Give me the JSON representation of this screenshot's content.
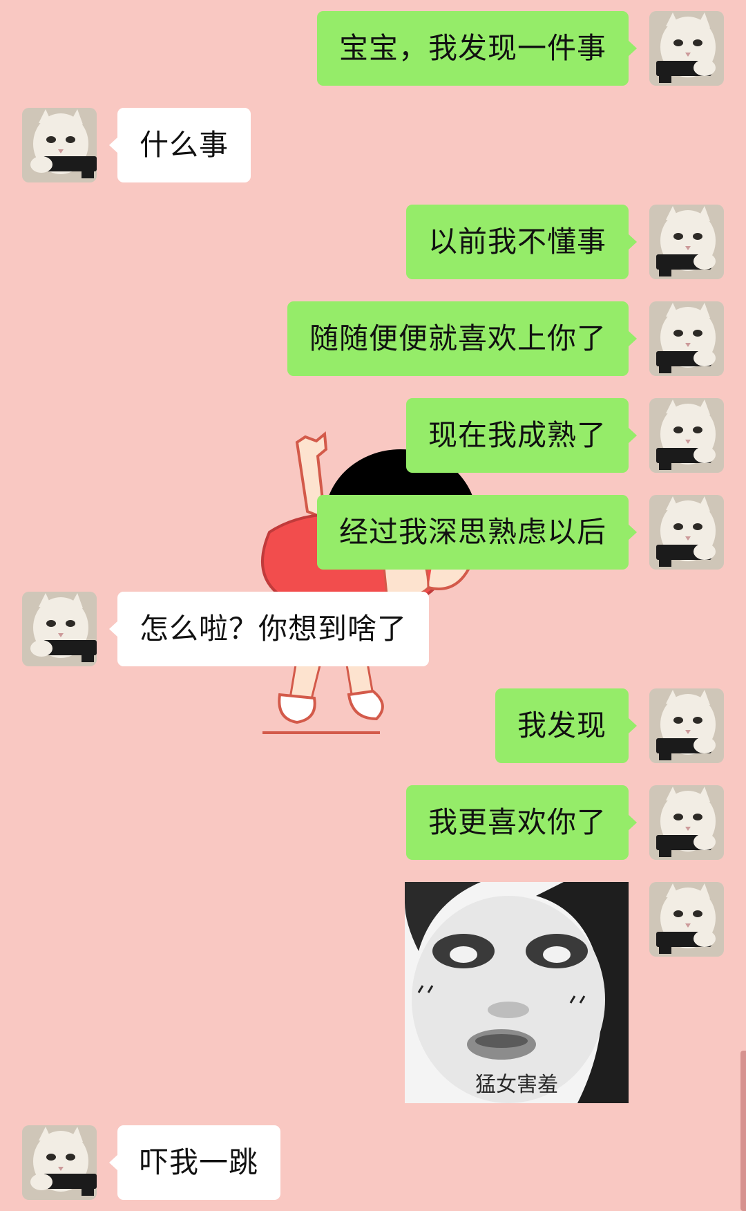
{
  "chat": {
    "background_color": "#f9c8c2",
    "outgoing_bubble_color": "#95ec69",
    "incoming_bubble_color": "#ffffff",
    "messages": [
      {
        "side": "out",
        "type": "text",
        "text": "宝宝，我发现一件事"
      },
      {
        "side": "in",
        "type": "text",
        "text": "什么事"
      },
      {
        "side": "out",
        "type": "text",
        "text": "以前我不懂事"
      },
      {
        "side": "out",
        "type": "text",
        "text": "随随便便就喜欢上你了"
      },
      {
        "side": "out",
        "type": "text",
        "text": "现在我成熟了"
      },
      {
        "side": "out",
        "type": "text",
        "text": "经过我深思熟虑以后"
      },
      {
        "side": "in",
        "type": "text",
        "text": "怎么啦？你想到啥了"
      },
      {
        "side": "out",
        "type": "text",
        "text": "我发现"
      },
      {
        "side": "out",
        "type": "text",
        "text": "我更喜欢你了"
      },
      {
        "side": "out",
        "type": "sticker",
        "caption": "猛女害羞"
      },
      {
        "side": "in",
        "type": "text",
        "text": "吓我一跳"
      }
    ]
  },
  "avatar_icon": "cat-with-gun-avatar",
  "background_icon": "cartoon-dancing-kid"
}
